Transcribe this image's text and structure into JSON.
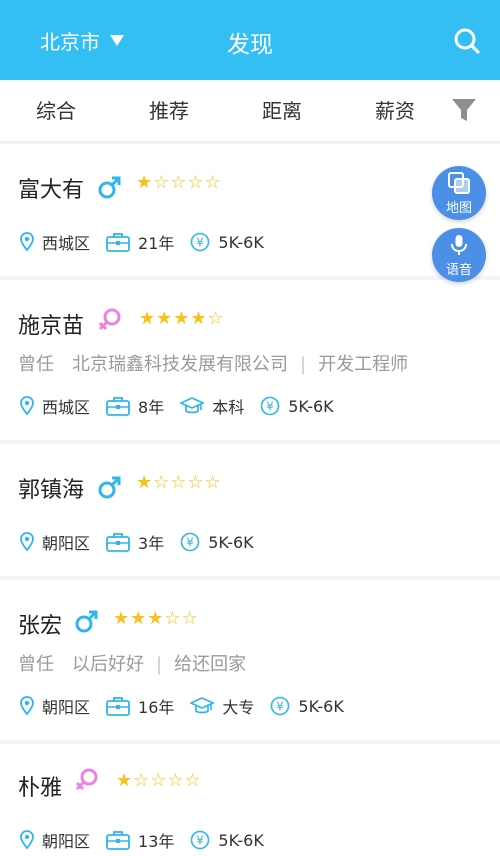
{
  "header": {
    "city": "北京市",
    "title": "发现",
    "icons": {
      "dropdown": "caret-down-icon",
      "search": "search-icon"
    }
  },
  "tabs": [
    {
      "label": "综合"
    },
    {
      "label": "推荐"
    },
    {
      "label": "距离"
    },
    {
      "label": "薪资"
    }
  ],
  "filter_icon": "filter-icon",
  "floating": {
    "map_label": "地图",
    "voice_label": "语音"
  },
  "colors": {
    "brand": "#33bff4",
    "male": "#2fb6ea",
    "female": "#ee82e0",
    "star": "#f7c21a",
    "fab": "#4b8fe6"
  },
  "candidates": [
    {
      "name": "富大有",
      "gender": "male",
      "rating": 1,
      "stars": "★☆☆☆☆",
      "district": "西城区",
      "experience": "21年",
      "salary": "5K-6K"
    },
    {
      "name": "施京苗",
      "gender": "female",
      "rating": 4,
      "stars": "★★★★☆",
      "past_prefix": "曾任",
      "company": "北京瑞鑫科技发展有限公司",
      "position": "开发工程师",
      "district": "西城区",
      "experience": "8年",
      "education": "本科",
      "salary": "5K-6K"
    },
    {
      "name": "郭镇海",
      "gender": "male",
      "rating": 1,
      "stars": "★☆☆☆☆",
      "district": "朝阳区",
      "experience": "3年",
      "salary": "5K-6K"
    },
    {
      "name": "张宏",
      "gender": "male",
      "rating": 3,
      "stars": "★★★☆☆",
      "past_prefix": "曾任",
      "company": "以后好好",
      "position": "给还回家",
      "district": "朝阳区",
      "experience": "16年",
      "education": "大专",
      "salary": "5K-6K"
    },
    {
      "name": "朴雅",
      "gender": "female",
      "rating": 1,
      "stars": "★☆☆☆☆",
      "district": "朝阳区",
      "experience": "13年",
      "salary": "5K-6K"
    }
  ]
}
